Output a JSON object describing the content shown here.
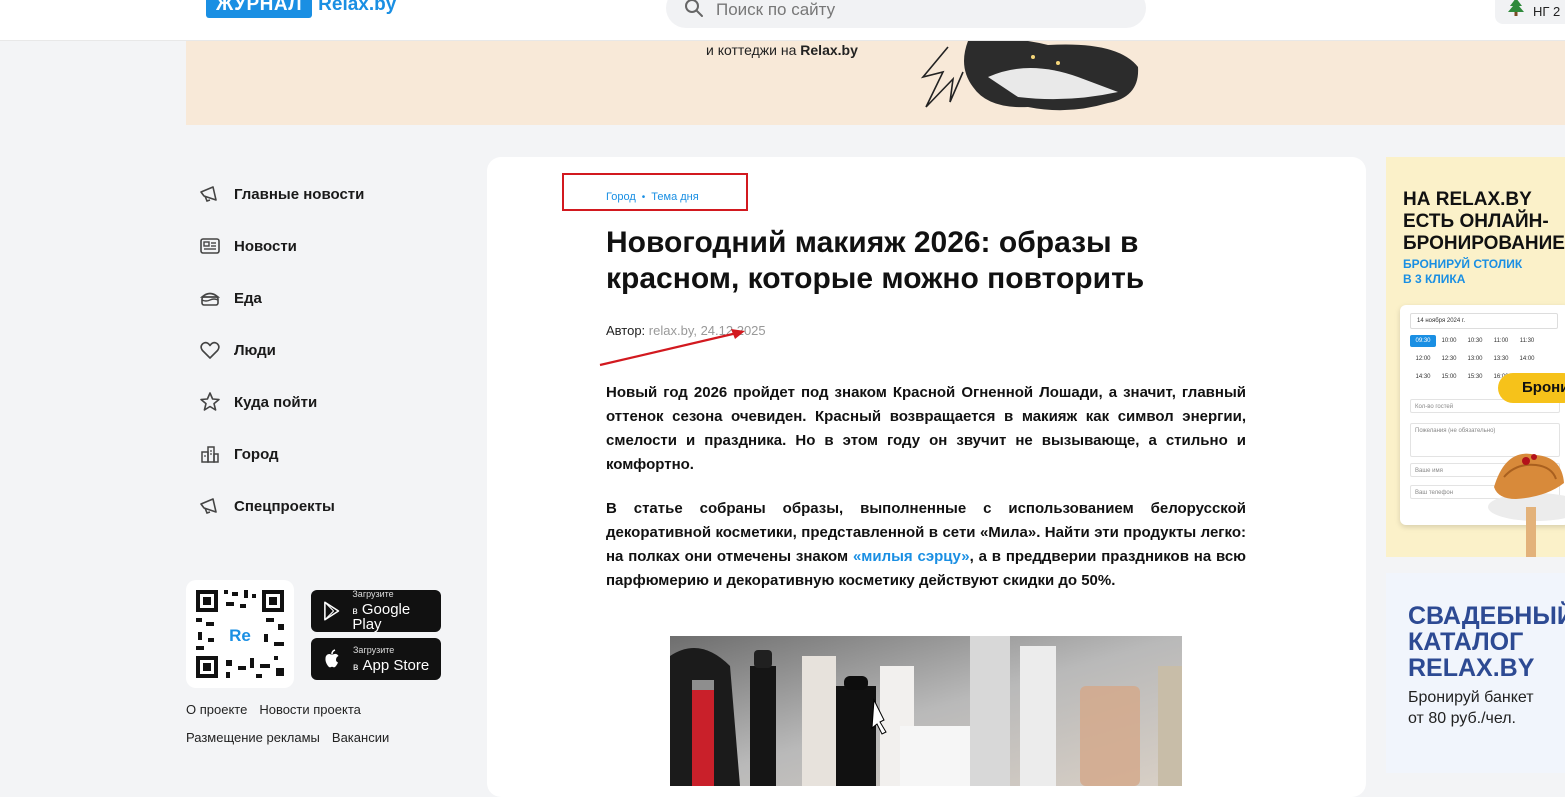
{
  "header": {
    "logo_journal": "ЖУРНАЛ",
    "logo_relax": "Relax.by",
    "search_placeholder": "Поиск по сайту",
    "ng_label": "НГ 2"
  },
  "banner": {
    "line": "и коттеджи на",
    "brand": "Relax.by"
  },
  "sidebar": {
    "items": [
      {
        "label": "Главные новости",
        "icon": "megaphone-icon"
      },
      {
        "label": "Новости",
        "icon": "newspaper-icon"
      },
      {
        "label": "Еда",
        "icon": "cake-icon"
      },
      {
        "label": "Люди",
        "icon": "heart-icon"
      },
      {
        "label": "Куда пойти",
        "icon": "star-icon"
      },
      {
        "label": "Город",
        "icon": "buildings-icon"
      },
      {
        "label": "Спецпроекты",
        "icon": "megaphone-icon"
      }
    ],
    "qr_label": "Re",
    "google_play": {
      "small": "Загрузите",
      "big": "Google Play",
      "prefix": "в"
    },
    "app_store": {
      "small": "Загрузите",
      "big": "App Store",
      "prefix": "в"
    },
    "footer_links": [
      "О проекте",
      "Новости проекта",
      "Размещение рекламы",
      "Вакансии"
    ]
  },
  "article": {
    "breadcrumb": [
      "Город",
      "Тема дня"
    ],
    "title": "Новогодний макияж 2026: образы в красном, которые можно повторить",
    "author_label": "Автор:",
    "author_value": "relax.by, 24.12.2025",
    "para1": "Новый год 2026 пройдет под знаком Красной Огненной Лошади, а значит, главный оттенок сезона очевиден. Красный возвращается в макияж как символ энергии, смелости и праздника. Но в этом году он звучит не вызывающе, а стильно и комфортно.",
    "para2_start": "В статье собраны образы, выполненные с использованием белорусской декоративной косметики, представленной в сети «Мила». Найти эти продукты легко: на полках они отмечены знаком ",
    "para2_link": "«милыя сэрцу»",
    "para2_end": ", а в преддверии праздников на всю парфюмерию и декоративную косметику действуют скидки до 50%."
  },
  "ads": {
    "ad1_title_1": "НА RELAX.BY",
    "ad1_title_2": "ЕСТЬ ОНЛАЙН-",
    "ad1_title_3": "БРОНИРОВАНИЕ",
    "ad1_sub_1": "БРОНИРУЙ СТОЛИК",
    "ad1_sub_2": "В 3 КЛИКА",
    "cal_date": "14 ноября 2024 г.",
    "cal_slots": [
      "09:30",
      "10:00",
      "10:30",
      "11:00",
      "11:30",
      "",
      "12:00",
      "12:30",
      "13:00",
      "13:30",
      "14:00",
      "",
      "14:30",
      "15:00",
      "15:30",
      "16:00",
      "",
      ""
    ],
    "cal_guests": "Кол-во гостей",
    "cal_comment": "Пожелания (не обязательно)",
    "cal_name": "Ваше имя",
    "cal_phone": "Ваш телефон",
    "ad1_button": "Брони",
    "ad2_title_1": "СВАДЕБНЫЙ",
    "ad2_title_2": "КАТАЛОГ",
    "ad2_title_3": "RELAX.BY",
    "ad2_sub_1": "Бронируй банкет",
    "ad2_sub_2": "от 80 руб./чел."
  },
  "colors": {
    "accent": "#1a8fe3",
    "highlight": "#d2191f",
    "banner_bg": "#f8e9d8"
  }
}
